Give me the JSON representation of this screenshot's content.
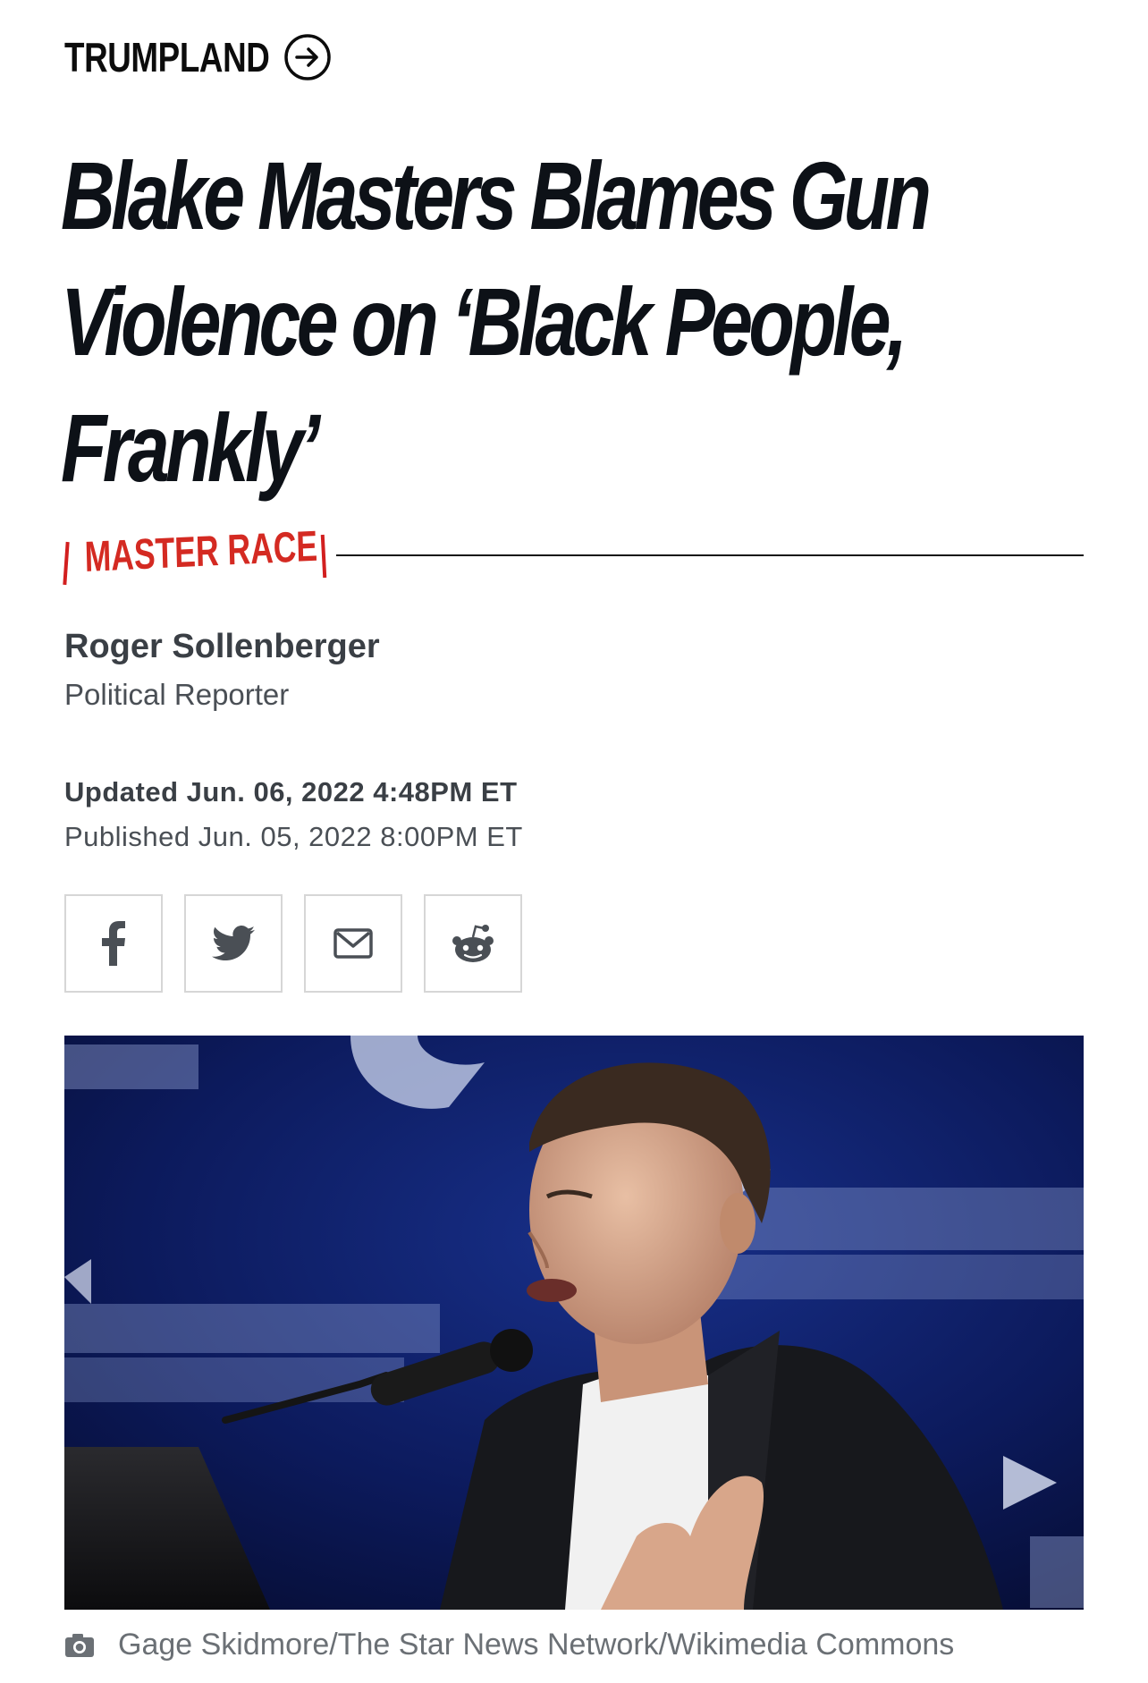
{
  "section": {
    "label": "TRUMPLAND",
    "arrow_icon": "arrow-right-circle-icon"
  },
  "headline": "Blake Masters Blames Gun Violence on ‘Black People, Frankly’",
  "tag": {
    "label": "MASTER RACE",
    "color": "#d42a22"
  },
  "author": {
    "name": "Roger Sollenberger",
    "role": "Political Reporter"
  },
  "dates": {
    "updated": "Updated Jun. 06, 2022 4:48PM ET",
    "published": "Published Jun. 05, 2022 8:00PM ET"
  },
  "share": [
    {
      "icon": "facebook-icon"
    },
    {
      "icon": "twitter-icon"
    },
    {
      "icon": "email-icon"
    },
    {
      "icon": "reddit-icon"
    }
  ],
  "photo": {
    "caption_icon": "camera-icon",
    "credit": "Gage Skidmore/The Star News Network/Wikimedia Commons",
    "backdrop_color": "#0a1650"
  }
}
